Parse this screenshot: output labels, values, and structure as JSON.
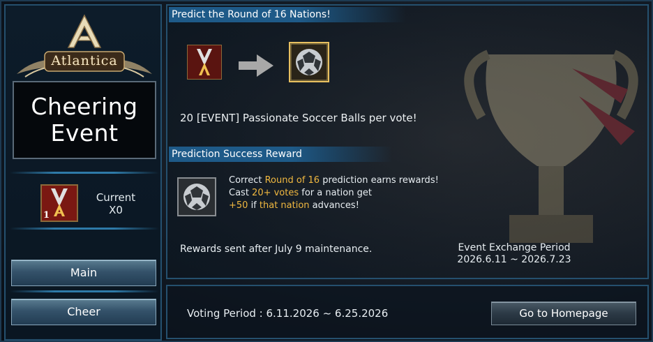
{
  "sidebar": {
    "logo_text": "Atlantica",
    "title": "Cheering\nEvent",
    "ticket_count": "1",
    "current_label": "Current",
    "current_value": "X0",
    "buttons": [
      {
        "label": "Main"
      },
      {
        "label": "Cheer"
      }
    ]
  },
  "predict": {
    "header": "Predict the Round of 16 Nations!",
    "description": "20 [EVENT] Passionate Soccer Balls per vote!"
  },
  "reward": {
    "header": "Prediction Success Reward",
    "line1_a": "Correct ",
    "line1_hl": "Round of 16",
    "line1_b": " prediction earns rewards!",
    "line2_a": "Cast ",
    "line2_hl": "20+ votes",
    "line2_b": " for a nation get",
    "line3_hl1": "+50",
    "line3_a": " if ",
    "line3_hl2": "that nation",
    "line3_b": " advances!",
    "sent_note": "Rewards sent after July 9 maintenance.",
    "exchange_label": "Event Exchange Period",
    "exchange_dates": "2026.6.11 ~ 2026.7.23"
  },
  "footer": {
    "voting": "Voting Period : 6.11.2026 ~  6.25.2026",
    "homepage_button": "Go to Homepage"
  },
  "colors": {
    "accent_border": "#25506e",
    "header_bg": "#1e5a88",
    "highlight": "#f0b840"
  }
}
